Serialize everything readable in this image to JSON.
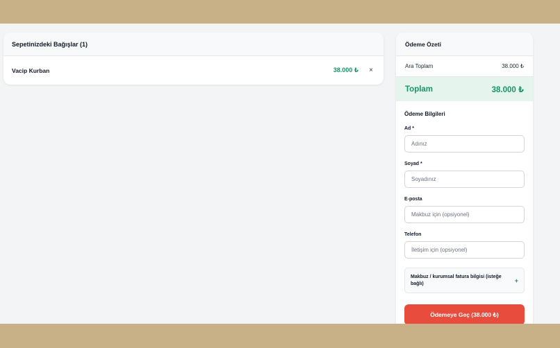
{
  "cart": {
    "title": "Sepetinizdeki Bağışlar (1)",
    "items": [
      {
        "name": "Vacip Kurban",
        "amount": "38.000 ₺",
        "remove": "×"
      }
    ]
  },
  "summary": {
    "title": "Ödeme Özeti",
    "subtotal_label": "Ara Toplam",
    "subtotal_value": "38.000 ₺",
    "total_label": "Toplam",
    "total_value": "38.000 ₺"
  },
  "payment": {
    "title": "Ödeme Bilgileri",
    "first_name_label": "Ad *",
    "first_name_placeholder": "Adınız",
    "last_name_label": "Soyad *",
    "last_name_placeholder": "Soyadınız",
    "email_label": "E-posta",
    "email_placeholder": "Makbuz için (opsiyonel)",
    "phone_label": "Telefon",
    "phone_placeholder": "İletişim için (opsiyonel)",
    "invoice_toggle": "Makbuz / kurumsal fatura bilgisi (isteğe bağlı)",
    "invoice_toggle_icon": "+",
    "submit_label": "Ödemeye Geç (38.000 ₺)"
  },
  "colors": {
    "accent_green": "#16966a",
    "button_red": "#e84c3d",
    "band": "#c9b187"
  }
}
